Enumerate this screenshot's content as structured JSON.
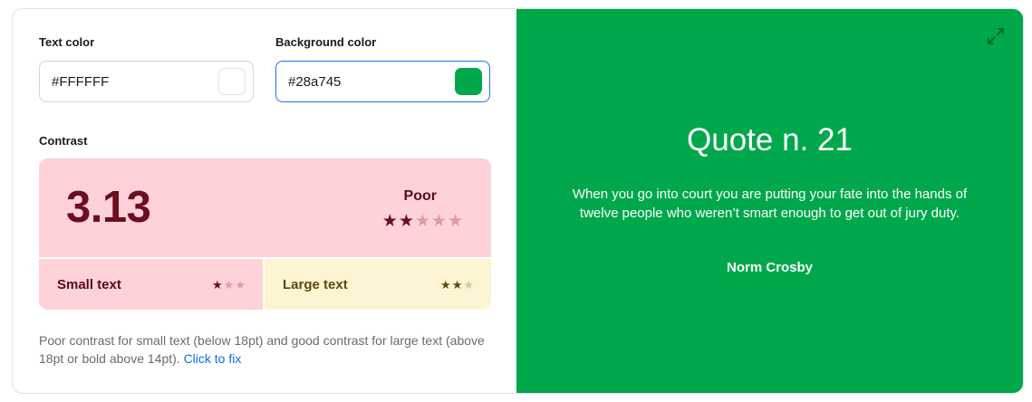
{
  "inputs": {
    "text_color": {
      "label": "Text color",
      "value": "#FFFFFF",
      "swatch": "#FFFFFF"
    },
    "background_color": {
      "label": "Background color",
      "value": "#28a745",
      "swatch": "#00a84b"
    }
  },
  "contrast": {
    "label": "Contrast",
    "ratio": "3.13",
    "rating": "Poor",
    "rating_stars": 2,
    "max_stars": 5,
    "small_text": {
      "label": "Small text",
      "stars": 1,
      "max_stars": 3
    },
    "large_text": {
      "label": "Large text",
      "stars": 2,
      "max_stars": 3
    }
  },
  "note": {
    "text": "Poor contrast for small text (below 18pt) and good contrast for large text (above 18pt or bold above 14pt).",
    "link": "Click to fix"
  },
  "preview": {
    "title": "Quote n. 21",
    "quote": "When you go into court you are putting your fate into the hands of twelve people who weren’t smart enough to get out of jury duty.",
    "author": "Norm Crosby",
    "icon": "expand-icon"
  },
  "colors": {
    "poor_bg": "#ffd1d9",
    "poor_text": "#6b0e1f",
    "large_bg": "#fcf4d2",
    "large_text": "#5b4a10",
    "preview_bg": "#00a84b",
    "focus": "#1a73e8",
    "link": "#0a6ee8"
  }
}
